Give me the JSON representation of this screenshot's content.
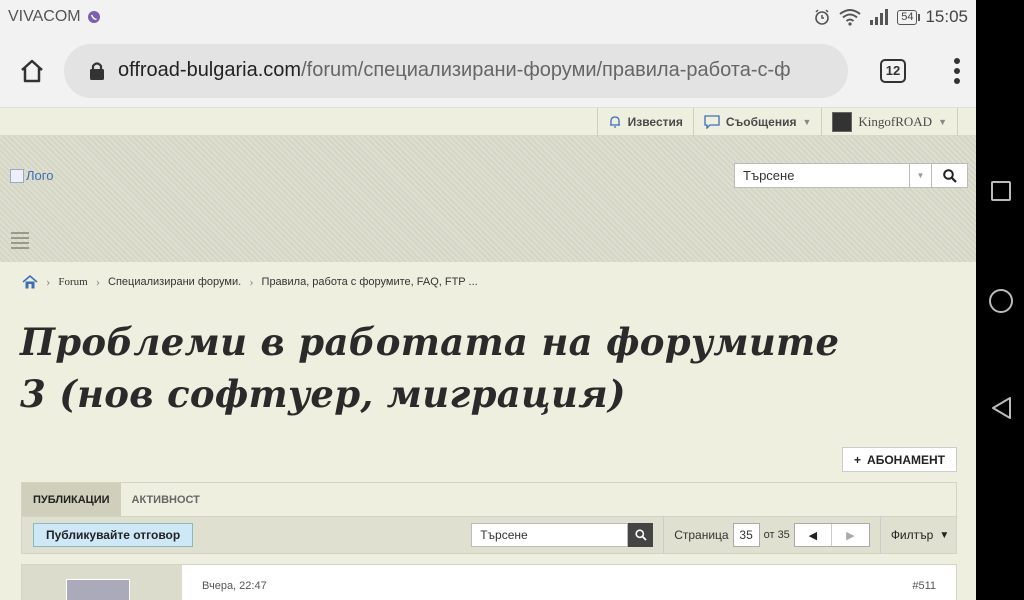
{
  "status": {
    "carrier": "VIVACOM",
    "battery": "54",
    "time": "15:05"
  },
  "browser": {
    "url_host": "offroad-bulgaria.com",
    "url_path": "/forum/специализирани-форуми/правила-работа-с-ф",
    "tab_count": "12"
  },
  "topbar": {
    "alerts": "Известия",
    "messages": "Съобщения",
    "user": "KingofROAD"
  },
  "header": {
    "logo_alt": "Лого",
    "search_placeholder": "Търсене"
  },
  "breadcrumb": {
    "items": [
      "Forum",
      "Специализирани форуми.",
      "Правила, работа с форумите, FAQ, FTP ..."
    ]
  },
  "thread": {
    "title": "Проблеми в работата на форумите 3 (нов софтуер, миграция)",
    "subscribe": "АБОНАМЕНТ"
  },
  "tabs": [
    "ПУБЛИКАЦИИ",
    "АКТИВНОСТ"
  ],
  "toolbar": {
    "reply": "Публикувайте отговор",
    "search_placeholder": "Търсене",
    "page_label": "Страница",
    "page_current": "35",
    "page_of": "от 35",
    "filter": "Филтър"
  },
  "post": {
    "date": "Вчера, 22:47",
    "number": "#511"
  }
}
